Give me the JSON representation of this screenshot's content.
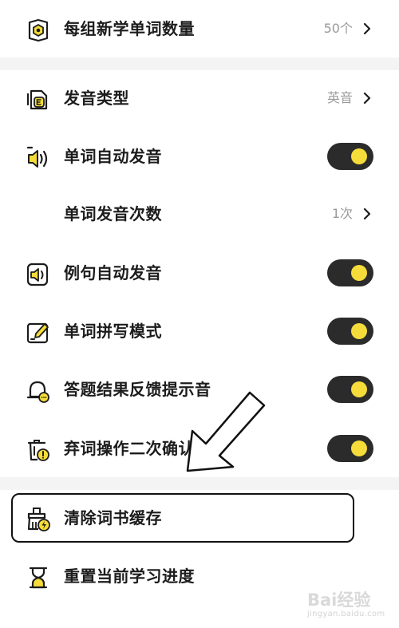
{
  "settings": {
    "group_count": {
      "label": "每组新学单词数量",
      "value": "50个"
    },
    "pronunciation_type": {
      "label": "发音类型",
      "value": "英音"
    },
    "word_auto_play": {
      "label": "单词自动发音",
      "toggle": "on"
    },
    "word_play_times": {
      "label": "单词发音次数",
      "value": "1次"
    },
    "sentence_auto_play": {
      "label": "例句自动发音",
      "toggle": "on"
    },
    "spelling_mode": {
      "label": "单词拼写模式",
      "toggle": "on"
    },
    "answer_feedback_sound": {
      "label": "答题结果反馈提示音",
      "toggle": "on"
    },
    "discard_confirm": {
      "label": "弃词操作二次确认",
      "toggle": "on"
    },
    "clear_cache": {
      "label": "清除词书缓存"
    },
    "reset_progress": {
      "label": "重置当前学习进度"
    }
  },
  "icons": {
    "group_count": "book-hexagon-icon",
    "pronunciation_type": "pronunciation-type-icon",
    "word_auto_play": "speaker-icon",
    "sentence_auto_play": "speaker-doc-icon",
    "spelling_mode": "edit-pen-icon",
    "answer_feedback_sound": "bell-icon",
    "discard_confirm": "trash-warning-icon",
    "clear_cache": "broom-bolt-icon",
    "reset_progress": "hourglass-icon"
  },
  "colors": {
    "accent": "#f5dc3a",
    "toggle_track": "#2b2b2b",
    "divider": "#f4f4f4"
  },
  "watermark": {
    "main": "Bai经验",
    "sub": "jingyan.baidu.com"
  }
}
